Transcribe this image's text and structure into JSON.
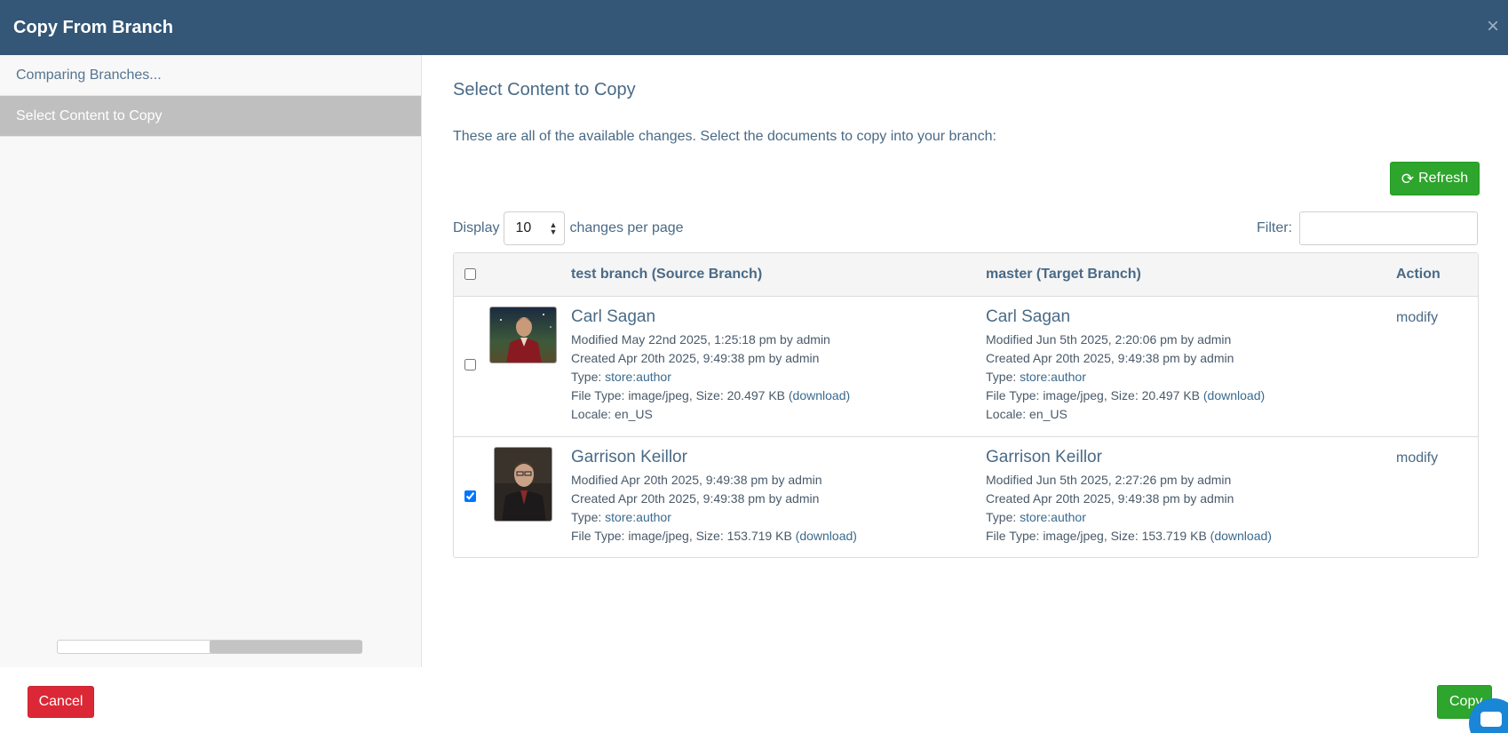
{
  "modal": {
    "title": "Copy From Branch",
    "close": "×"
  },
  "sidebar": {
    "steps": [
      {
        "label": "Comparing Branches..."
      },
      {
        "label": "Select Content to Copy"
      }
    ]
  },
  "main": {
    "heading": "Select Content to Copy",
    "description": "These are all of the available changes. Select the documents to copy into your branch:",
    "refresh_label": "Refresh",
    "display_label": "Display",
    "page_size": "10",
    "per_page_label": "changes per page",
    "filter_label": "Filter:",
    "filter_value": ""
  },
  "table": {
    "headers": {
      "source": "test branch (Source Branch)",
      "target": "master (Target Branch)",
      "action": "Action"
    },
    "rows": [
      {
        "checked": false,
        "source": {
          "name": "Carl Sagan",
          "modified": "Modified May 22nd 2025, 1:25:18 pm by admin",
          "created": "Created Apr 20th 2025, 9:49:38 pm by admin",
          "type_prefix": "Type: ",
          "type": "store:author",
          "file": "File Type: image/jpeg, Size: 20.497 KB ",
          "download": "(download)",
          "locale": "Locale: en_US"
        },
        "target": {
          "name": "Carl Sagan",
          "modified": "Modified Jun 5th 2025, 2:20:06 pm by admin",
          "created": "Created Apr 20th 2025, 9:49:38 pm by admin",
          "type_prefix": "Type: ",
          "type": "store:author",
          "file": "File Type: image/jpeg, Size: 20.497 KB ",
          "download": "(download)",
          "locale": "Locale: en_US"
        },
        "action": "modify"
      },
      {
        "checked": true,
        "source": {
          "name": "Garrison Keillor",
          "modified": "Modified Apr 20th 2025, 9:49:38 pm by admin",
          "created": "Created Apr 20th 2025, 9:49:38 pm by admin",
          "type_prefix": "Type: ",
          "type": "store:author",
          "file": "File Type: image/jpeg, Size: 153.719 KB ",
          "download": "(download)"
        },
        "target": {
          "name": "Garrison Keillor",
          "modified": "Modified Jun 5th 2025, 2:27:26 pm by admin",
          "created": "Created Apr 20th 2025, 9:49:38 pm by admin",
          "type_prefix": "Type: ",
          "type": "store:author",
          "file": "File Type: image/jpeg, Size: 153.719 KB ",
          "download": "(download)"
        },
        "action": "modify"
      }
    ]
  },
  "footer": {
    "cancel_label": "Cancel",
    "copy_label": "Copy"
  },
  "colors": {
    "header_bg": "#345677",
    "primary_green": "#2ea52c",
    "danger_red": "#dc2836",
    "text_blue": "#496a86",
    "active_step_bg": "#bfbfbf"
  }
}
